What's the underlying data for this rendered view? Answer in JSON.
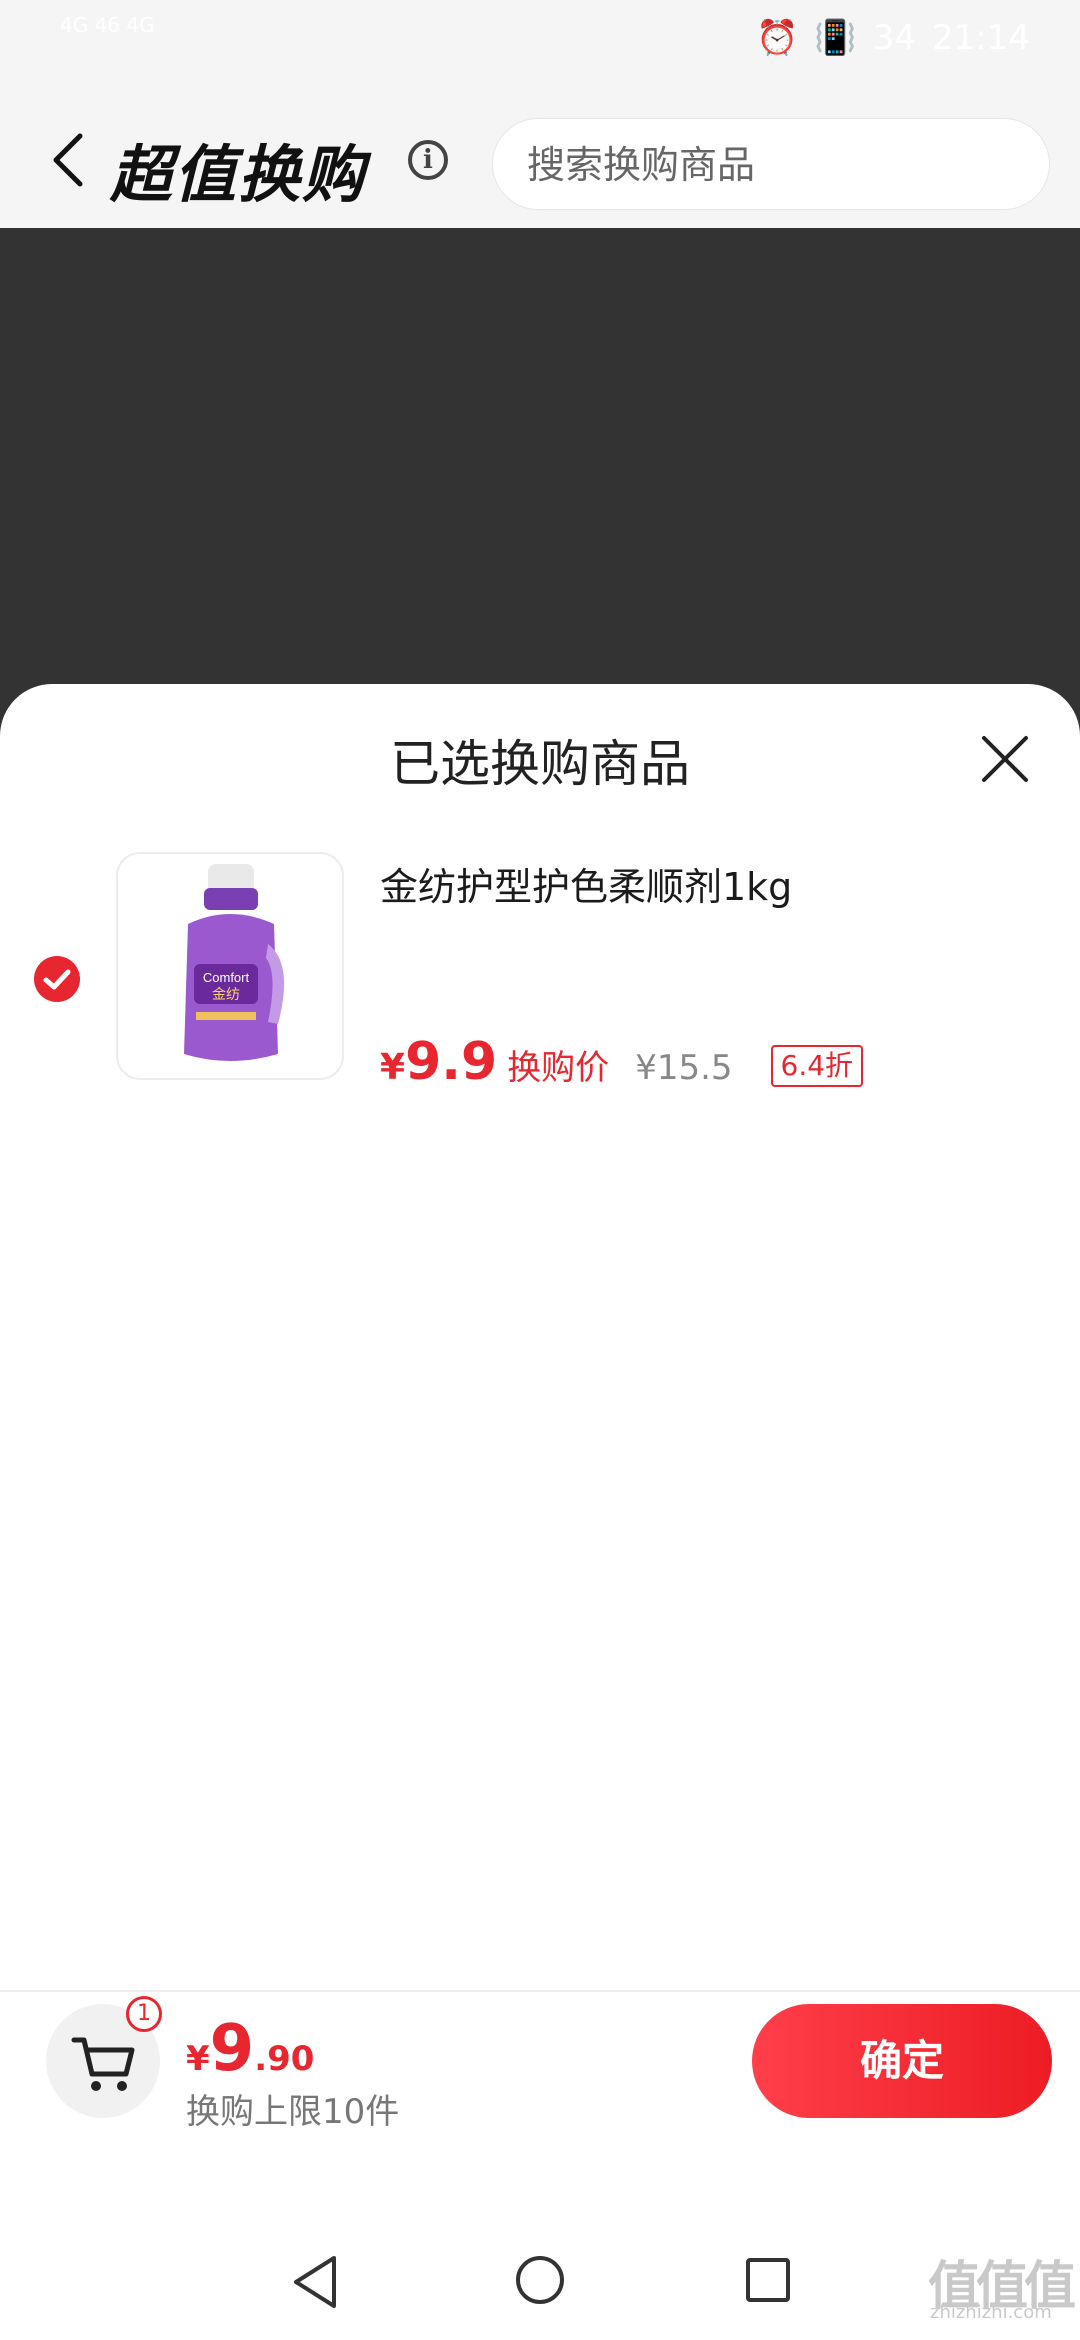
{
  "status_bar": {
    "left_text": "4G 46 4G",
    "time": "21:14",
    "battery": "34"
  },
  "header": {
    "title": "超值换购",
    "search_placeholder": "搜索换购商品"
  },
  "sheet": {
    "title": "已选换购商品",
    "item": {
      "name": "金纺护型护色柔顺剂1kg",
      "price_symbol": "¥",
      "price": "9.9",
      "price_label": "换购价",
      "original_price": "¥15.5",
      "discount": "6.4折",
      "brand_on_bottle": "Comfort 金纺"
    }
  },
  "bottom_bar": {
    "cart_count": "1",
    "total_symbol": "¥",
    "total_int": "9",
    "total_dec": ".90",
    "limit_text": "换购上限10件",
    "confirm_label": "确定"
  },
  "watermark": {
    "main": "值值值",
    "sub": "zhizhizhi.com"
  },
  "colors": {
    "accent": "#e7262f",
    "overlay": "#333333",
    "header_bg": "#f5f5f5"
  }
}
